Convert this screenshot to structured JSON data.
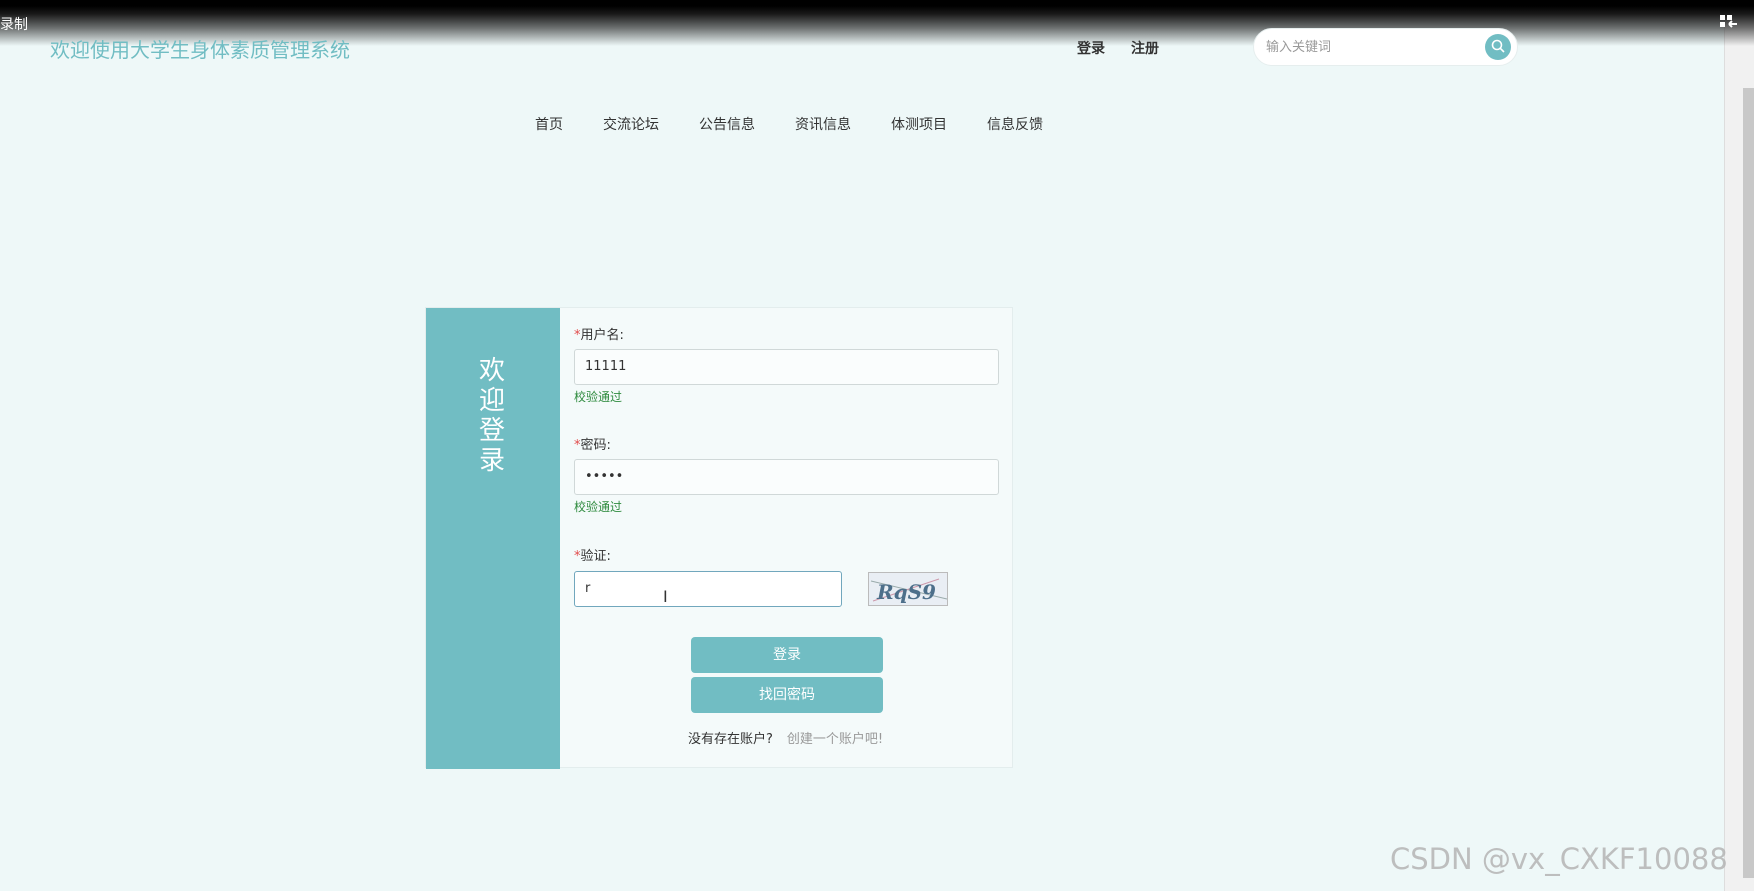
{
  "recorder": {
    "label": "录制",
    "icon": "exit-fullscreen-icon"
  },
  "header": {
    "site_title": "欢迎使用大学生身体素质管理系统",
    "login_link": "登录",
    "register_link": "注册",
    "search_placeholder": "输入关键词",
    "search_icon": "search-icon"
  },
  "nav": {
    "items": [
      "首页",
      "交流论坛",
      "公告信息",
      "资讯信息",
      "体测项目",
      "信息反馈"
    ]
  },
  "login": {
    "side_title": "欢迎登录",
    "username_label": "用户名:",
    "username_value": "11111",
    "username_status": "校验通过",
    "password_label": "密码:",
    "password_value": "•••••",
    "password_status": "校验通过",
    "captcha_label": "验证:",
    "captcha_value": "r",
    "captcha_text": "RqS9",
    "required_mark": "*",
    "login_button": "登录",
    "forgot_button": "找回密码",
    "no_account_text": "没有存在账户?",
    "create_account_link": "创建一个账户吧!"
  },
  "colors": {
    "accent": "#71bdc3",
    "background": "#eef8f8",
    "valid": "#2e8b3e",
    "required": "#e24a4a"
  },
  "watermark": "CSDN @vx_CXKF10088"
}
